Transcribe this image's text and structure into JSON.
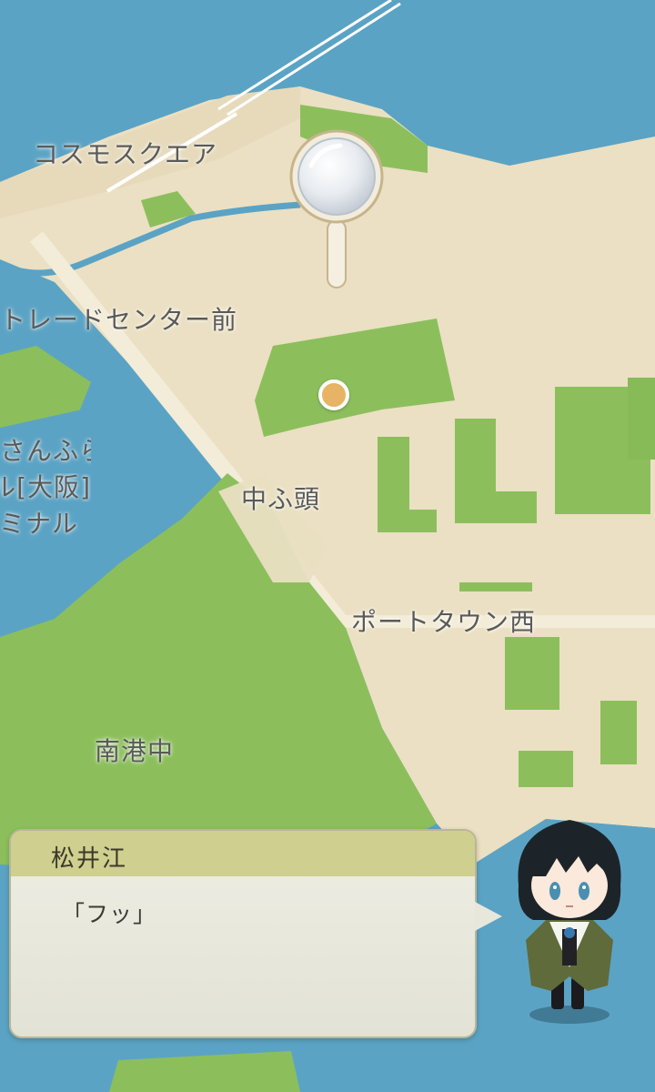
{
  "map": {
    "labels": {
      "cosmo_square": "コスモスクエア",
      "trade_center": "トレードセンター前",
      "ferry_terminal_line1": "さんふらわあ",
      "ferry_terminal_line2": "ターミナル[大阪]",
      "ferry_terminal_line3": "ターミナル",
      "chufuto": "中ふ頭",
      "port_town_nishi": "ポートタウン西",
      "nanko_naka": "南港中"
    },
    "colors": {
      "sea": "#5ba3c4",
      "land": "#ebe0c3",
      "park": "#8cbf5c",
      "label": "#5a5a58",
      "marker": "#e6b464"
    }
  },
  "dialog": {
    "speaker": "松井江",
    "text": "「フッ」"
  },
  "icons": {
    "loupe": "magnifier-icon",
    "marker": "current-location-icon",
    "character": "character-portrait"
  }
}
